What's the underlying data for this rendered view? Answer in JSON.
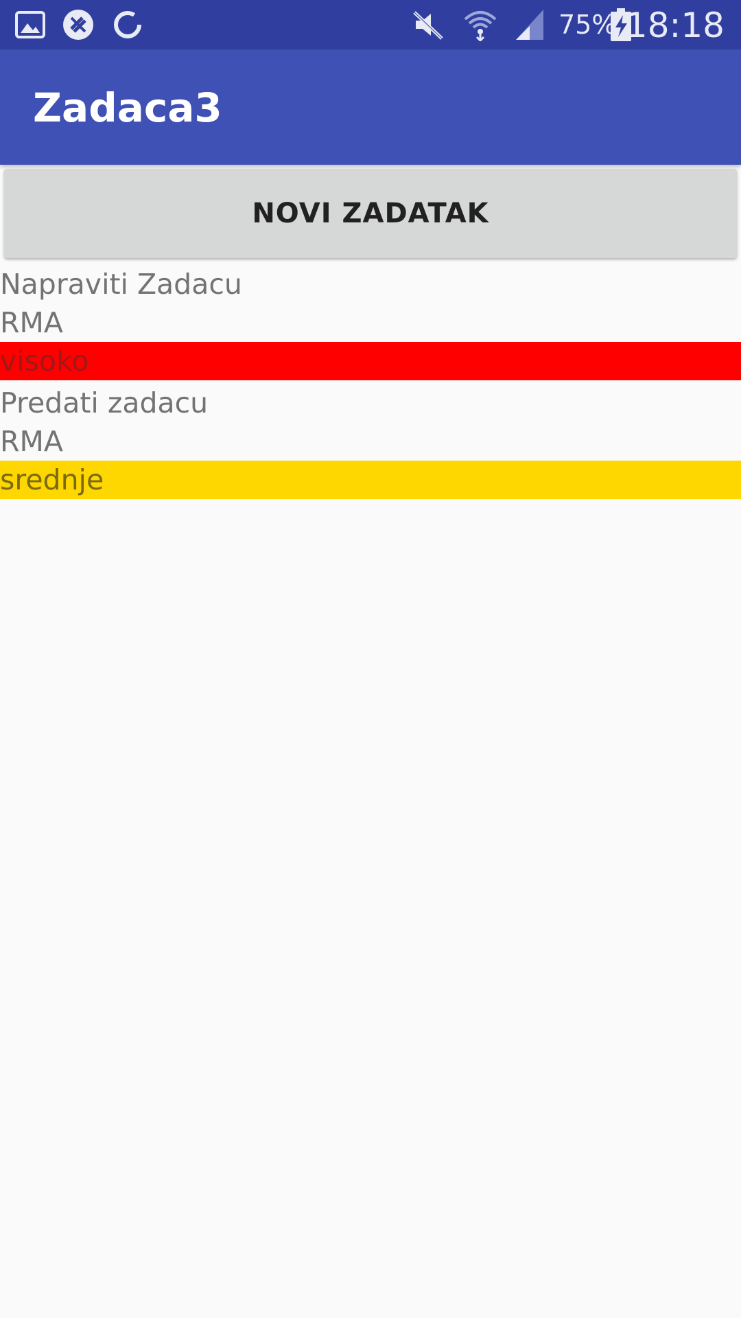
{
  "status_bar": {
    "left_icons": [
      "image-icon",
      "no-sync-icon",
      "loading-icon"
    ],
    "right_icons": [
      "mute-icon",
      "wifi-icon",
      "signal-icon",
      "battery-charging-icon"
    ],
    "battery_percent": "75%",
    "time": "18:18"
  },
  "app_bar": {
    "title": "Zadaca3"
  },
  "new_task_button": {
    "label": "NOVI ZADATAK"
  },
  "tasks": [
    {
      "name": "Napraviti Zadacu",
      "subject": "RMA",
      "priority": "visoko",
      "priority_color": "#ff0000",
      "priority_text_color": "#a11818"
    },
    {
      "name": "Predati zadacu",
      "subject": "RMA",
      "priority": "srednje",
      "priority_color": "#ffd700",
      "priority_text_color": "#7a6a10"
    }
  ],
  "colors": {
    "status_bar": "#303f9f",
    "app_bar": "#3f51b5",
    "button": "#d6d7d7",
    "background": "#fafafa"
  }
}
